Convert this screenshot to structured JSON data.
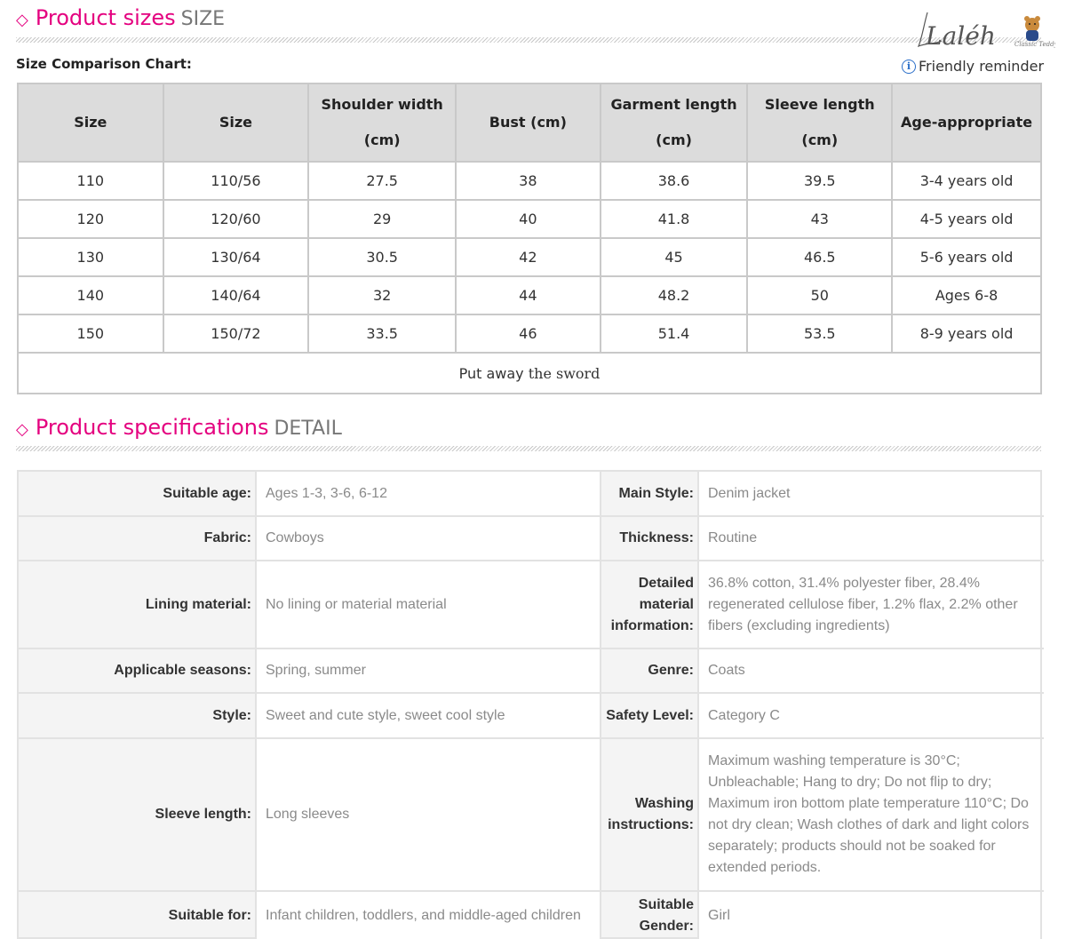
{
  "size_section": {
    "diamond": "◇",
    "title": "Product sizes",
    "subtitle": "SIZE",
    "chart_label": "Size Comparison Chart:",
    "reminder": "Friendly reminder",
    "logo_text": "Laléh",
    "logo_script": "Classic Teddy"
  },
  "size_table": {
    "headers": [
      "Size",
      "Size",
      "Shoulder width (cm)",
      "Bust (cm)",
      "Garment length (cm)",
      "Sleeve length (cm)",
      "Age-appropriate"
    ],
    "rows": [
      [
        "110",
        "110/56",
        "27.5",
        "38",
        "38.6",
        "39.5",
        "3-4 years old"
      ],
      [
        "120",
        "120/60",
        "29",
        "40",
        "41.8",
        "43",
        "4-5 years old"
      ],
      [
        "130",
        "130/64",
        "30.5",
        "42",
        "45",
        "46.5",
        "5-6 years old"
      ],
      [
        "140",
        "140/64",
        "32",
        "44",
        "48.2",
        "50",
        "Ages 6-8"
      ],
      [
        "150",
        "150/72",
        "33.5",
        "46",
        "51.4",
        "53.5",
        "8-9 years old"
      ]
    ],
    "footer_a": "Put away",
    "footer_b": "the sword"
  },
  "detail_section": {
    "diamond": "◇",
    "title": "Product specifications",
    "subtitle": "DETAIL"
  },
  "specs": [
    {
      "l1": "Suitable age:",
      "v1": "Ages 1-3, 3-6, 6-12",
      "l2": "Main Style:",
      "v2": "Denim jacket"
    },
    {
      "l1": "Fabric:",
      "v1": "Cowboys",
      "l2": "Thickness:",
      "v2": "Routine"
    },
    {
      "l1": "Lining material:",
      "v1": "No lining or material material",
      "l2": "Detailed material information:",
      "v2": "36.8% cotton, 31.4% polyester fiber, 28.4% regenerated cellulose fiber, 1.2% flax, 2.2% other fibers (excluding ingredients)"
    },
    {
      "l1": "Applicable seasons:",
      "v1": "Spring, summer",
      "l2": "Genre:",
      "v2": "Coats"
    },
    {
      "l1": "Style:",
      "v1": "Sweet and cute style, sweet cool style",
      "l2": "Safety Level:",
      "v2": "Category C"
    },
    {
      "l1": "Sleeve length:",
      "v1": "Long sleeves",
      "l2": "Washing instructions:",
      "v2": "Maximum washing temperature is 30°C; Unbleachable; Hang to dry; Do not flip to dry; Maximum iron bottom plate temperature 110°C; Do not dry clean; Wash clothes of dark and light colors separately; products should not be soaked for extended periods."
    },
    {
      "l1": "Suitable for:",
      "v1": "Infant children, toddlers, and middle-aged children",
      "l2": "Suitable Gender:",
      "v2": "Girl"
    }
  ]
}
